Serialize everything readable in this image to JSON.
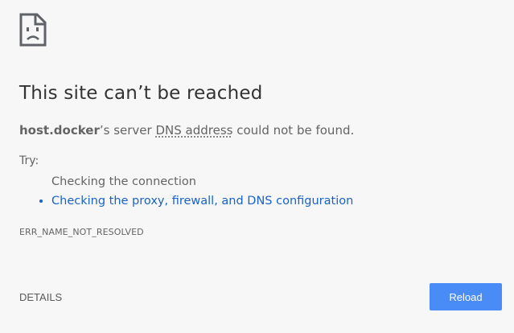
{
  "page": {
    "icon": "sad-document-icon",
    "title": "This site can’t be reached",
    "summary": {
      "host": "host.docker",
      "middle": "’s server ",
      "abbr": "DNS address",
      "end": " could not be found."
    },
    "try_label": "Try:",
    "suggestions": [
      {
        "label": "Checking the connection",
        "link": false
      },
      {
        "label": "Checking the proxy, firewall, and DNS configuration",
        "link": true
      }
    ],
    "error_code": "ERR_NAME_NOT_RESOLVED",
    "details_label": "DETAILS",
    "reload_label": "Reload"
  },
  "colors": {
    "background": "#f7f7f7",
    "text": "#646464",
    "title": "#333333",
    "link": "#1a62c9",
    "button": "#4a8cf7"
  }
}
